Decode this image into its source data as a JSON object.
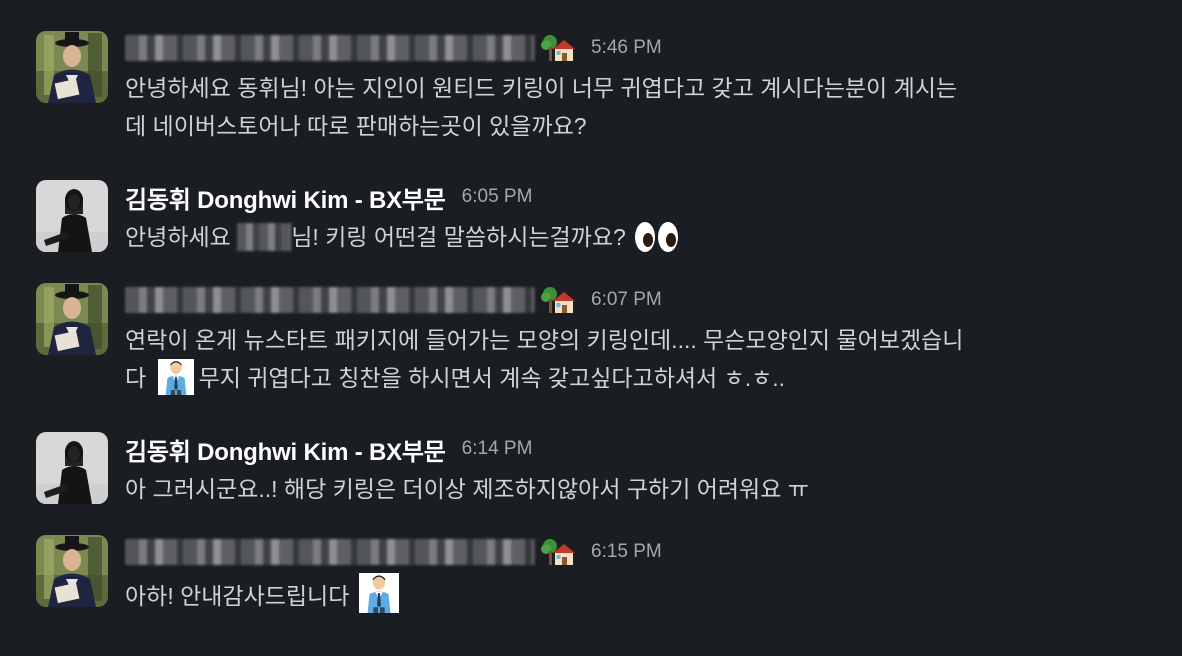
{
  "messages": [
    {
      "sender": "",
      "sender_redacted": true,
      "avatar": "hanbok-man-avatar",
      "status_icon": "house-with-tree-icon",
      "time": "5:46 PM",
      "lines": [
        "안녕하세요 동휘님! 아는 지인이 원티드 키링이 너무 귀엽다고 갖고 계시다는분이 계시는",
        "데 네이버스토어나 따로 판매하는곳이 있을까요?"
      ]
    },
    {
      "sender": "김동휘 Donghwi Kim - BX부문",
      "sender_redacted": false,
      "avatar": "dark-portrait-avatar",
      "time": "6:05 PM",
      "text_before": "안녕하세요 ",
      "text_after": "님! 키링 어떤걸 말씀하시는걸까요?",
      "emoji": "eyes-icon"
    },
    {
      "sender": "",
      "sender_redacted": true,
      "avatar": "hanbok-man-avatar",
      "status_icon": "house-with-tree-icon",
      "time": "6:07 PM",
      "line1": "연락이 온게 뉴스타트 패키지에 들어가는 모양의 키링인데.... 무슨모양인지 물어보겠습니",
      "line2_before": "다 ",
      "line2_after": "무지 귀엽다고 칭찬을 하시면서 계속 갖고싶다고하셔서 ㅎ.ㅎ..",
      "emoji": "office-worker-icon"
    },
    {
      "sender": "김동휘 Donghwi Kim - BX부문",
      "sender_redacted": false,
      "avatar": "dark-portrait-avatar",
      "time": "6:14 PM",
      "text": "아 그러시군요..! 해당 키링은 더이상 제조하지않아서 구하기 어려워요 ㅠ"
    },
    {
      "sender": "",
      "sender_redacted": true,
      "avatar": "hanbok-man-avatar",
      "status_icon": "house-with-tree-icon",
      "time": "6:15 PM",
      "text": "아하! 안내감사드립니다 ",
      "emoji": "office-worker-icon"
    }
  ],
  "colors": {
    "background": "#1a1d21",
    "text": "#d1d2d3",
    "sender": "#ffffff",
    "timestamp": "#a6a7a9"
  }
}
